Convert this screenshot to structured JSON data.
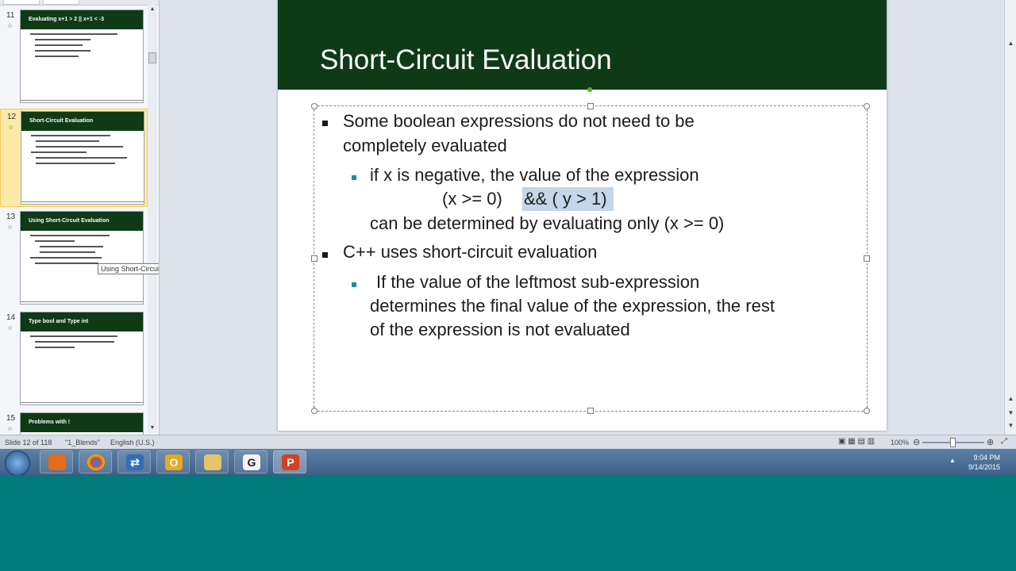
{
  "thumbnails": [
    {
      "number": "11",
      "title": "Evaluating x+1 > 2 || x+1 < -3"
    },
    {
      "number": "12",
      "title": "Short-Circuit Evaluation"
    },
    {
      "number": "13",
      "title": "Using Short-Circuit Evaluation"
    },
    {
      "number": "14",
      "title": "Type bool and Type int"
    },
    {
      "number": "15",
      "title": "Problems with !"
    }
  ],
  "tooltip": "Using Short-Circuit Evaluation",
  "slide": {
    "title": "Short-Circuit Evaluation",
    "bullet1_line1": "Some boolean expressions do not need to be",
    "bullet1_line2": "completely evaluated",
    "sub1_line1": "if x is negative, the value of the expression",
    "sub1_expr_a": "(x >= 0)",
    "sub1_expr_b": "&& ( y > 1)",
    "sub1_line3": "can be determined by evaluating only (x >= 0)",
    "bullet2": "C++ uses short-circuit evaluation",
    "sub2_line1": "If the value of the leftmost sub-expression",
    "sub2_line2": "determines the final value of the expression, the rest",
    "sub2_line3": "of the expression is not evaluated"
  },
  "status": {
    "slide_info": "Slide 12 of 118",
    "theme": "\"1_Blends\"",
    "language": "English (U.S.)",
    "zoom": "100%"
  },
  "taskbar": {
    "time": "9:04 PM",
    "date": "9/14/2015",
    "apps": [
      "Firefox",
      "Chrome",
      "Remote Desktop",
      "Outlook",
      "File Explorer",
      "G",
      "PowerPoint"
    ]
  },
  "colors": {
    "slide_header": "#0f3a16",
    "sub_bullet": "#1d8aa8",
    "desktop": "#007a7a"
  }
}
